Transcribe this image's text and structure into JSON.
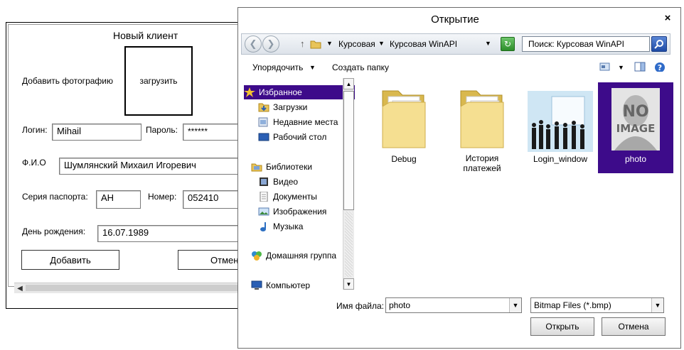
{
  "client_form": {
    "title": "Новый клиент",
    "photo_label": "Добавить фотографию",
    "upload_button": "загрузить",
    "login_label": "Логин:",
    "login_value": "Mihail",
    "password_label": "Пароль:",
    "password_value": "******",
    "fio_label": "Ф.И.О",
    "fio_value": "Шумлянский Михаил Игоревич",
    "passport_series_label": "Серия паспорта:",
    "passport_series_value": "АН",
    "number_label": "Номер:",
    "number_value": "052410",
    "birthday_label": "День рождения:",
    "birthday_value": "16.07.1989",
    "add_button": "Добавить",
    "cancel_button": "Отмена",
    "scroll_left_icon": "chevron-left-icon"
  },
  "dialog": {
    "title": "Открытие",
    "close_glyph": "×",
    "address": {
      "crumbs": [
        "Курсовая",
        "Курсовая WinAPI"
      ],
      "search_placeholder": "Поиск: Курсовая WinAPI"
    },
    "toolbar": {
      "organize": "Упорядочить",
      "new_folder": "Создать папку"
    },
    "nav": {
      "favorites": "Избранное",
      "favorites_items": [
        "Загрузки",
        "Недавние места",
        "Рабочий стол"
      ],
      "libraries": "Библиотеки",
      "libraries_items": [
        "Видео",
        "Документы",
        "Изображения",
        "Музыка"
      ],
      "homegroup": "Домашняя группа",
      "computer": "Компьютер"
    },
    "files": [
      {
        "name": "Debug",
        "icon": "folder-icon"
      },
      {
        "name": "История платежей",
        "icon": "folder-icon"
      },
      {
        "name": "Login_window",
        "icon": "image-thumbnail"
      },
      {
        "name": "photo",
        "icon": "no-image-thumbnail",
        "thumb_text": "NO IMAGE"
      }
    ],
    "filename_label": "Имя файла:",
    "filename_value": "photo",
    "filter_value": "Bitmap Files (*.bmp)",
    "open_button": "Открыть",
    "cancel_button": "Отмена",
    "selection_color": "#3d0b8a"
  }
}
